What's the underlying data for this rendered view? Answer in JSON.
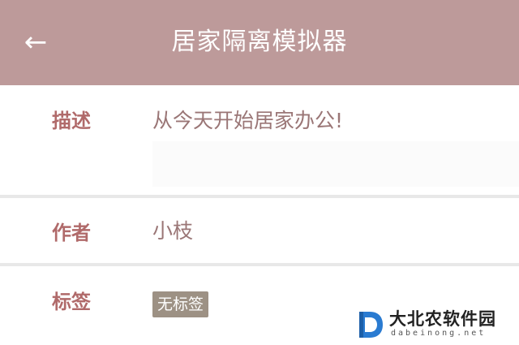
{
  "header": {
    "back_icon": "left-arrow-icon",
    "back_glyph": "←",
    "title": "居家隔离模拟器",
    "background": "#bd9a9a"
  },
  "description": {
    "label": "描述",
    "value": "从今天开始居家办公!"
  },
  "author": {
    "label": "作者",
    "value": "小枝"
  },
  "tags": {
    "label": "标签",
    "value": "无标签"
  },
  "watermark": {
    "name": "大北农软件园",
    "domain": "dabeinong.net"
  },
  "colors": {
    "accent": "#b06a6a",
    "tag_bg": "#9d9184",
    "divider": "#e8e8e8"
  }
}
